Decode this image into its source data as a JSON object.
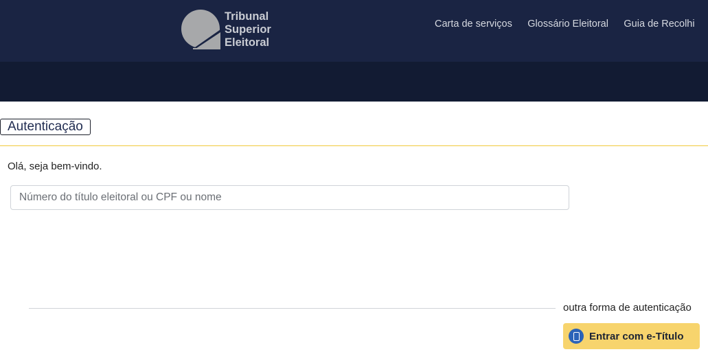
{
  "header": {
    "logo_lines": [
      "Tribunal",
      "Superior",
      "Eleitoral"
    ],
    "nav": [
      "Carta de serviços",
      "Glossário Eleitoral",
      "Guia de Recolhi"
    ]
  },
  "modal": {
    "title": "Autenticação",
    "greeting": "Olá, seja bem-vindo.",
    "search_placeholder": "Número do título eleitoral ou CPF ou nome",
    "other_auth_label": "outra forma de autenticação",
    "etitulo_button": "Entrar com e-Título"
  },
  "colors": {
    "header_bg": "#1a2443",
    "accent_gold": "#f1c93a",
    "button_bg": "#f7d46d",
    "icon_blue": "#2b63b8"
  },
  "icons": [
    "tse-logo-icon",
    "phone-icon"
  ]
}
